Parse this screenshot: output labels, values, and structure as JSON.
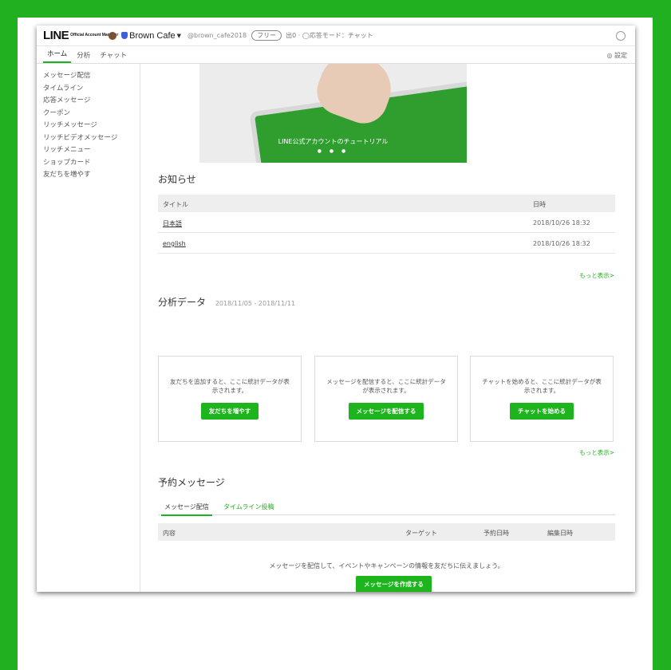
{
  "header": {
    "logo_main": "LINE",
    "logo_sub": "Official Account Manager",
    "account_name": "Brown Cafe",
    "account_id": "@brown_cafe2018",
    "plan": "フリー",
    "meta": "出0 · ◯応答モード：チャット"
  },
  "tabs": [
    "ホーム",
    "分析",
    "チャット"
  ],
  "settings_label": "◎ 設定",
  "sidebar": {
    "items": [
      "メッセージ配信",
      "タイムライン",
      "応答メッセージ",
      "クーポン",
      "リッチメッセージ",
      "リッチビデオメッセージ",
      "リッチメニュー",
      "ショップカード",
      "友だちを増やす"
    ]
  },
  "banner": {
    "caption": "LINE公式アカウントのチュートリアル",
    "dots": "● ● ●"
  },
  "news": {
    "title": "お知らせ",
    "col_title": "タイトル",
    "col_date": "日時",
    "rows": [
      {
        "title": "日本語",
        "date": "2018/10/26 18:32"
      },
      {
        "title": "english",
        "date": "2018/10/26 18:32"
      }
    ],
    "more": "もっと表示>"
  },
  "analytics": {
    "title": "分析データ",
    "date_range": "2018/11/05 - 2018/11/11",
    "cards": [
      {
        "desc": "友だちを追加すると、ここに統計データが表示されます。",
        "button": "友だちを増やす"
      },
      {
        "desc": "メッセージを配信すると、ここに統計データが表示されます。",
        "button": "メッセージを配信する"
      },
      {
        "desc": "チャットを始めると、ここに統計データが表示されます。",
        "button": "チャットを始める"
      }
    ],
    "more": "もっと表示>"
  },
  "scheduled": {
    "title": "予約メッセージ",
    "tabs": [
      "メッセージ配信",
      "タイムライン投稿"
    ],
    "columns": [
      "内容",
      "ターゲット",
      "予約日時",
      "編集日時"
    ],
    "empty_text": "メッセージを配信して、イベントやキャンペーンの情報を友だちに伝えましょう。",
    "create_button": "メッセージを作成する"
  },
  "colors": {
    "accent": "#1eb41e",
    "frame": "#20b020"
  }
}
